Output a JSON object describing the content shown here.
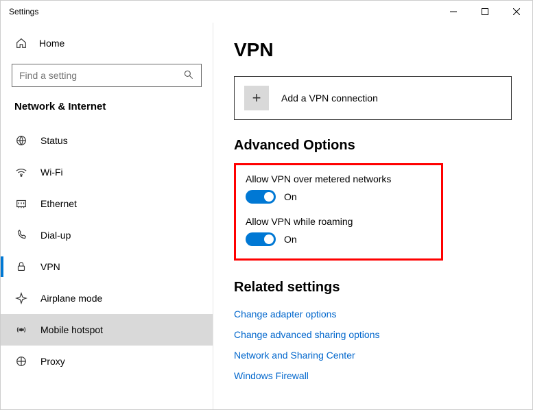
{
  "titlebar": {
    "title": "Settings"
  },
  "sidebar": {
    "home_label": "Home",
    "search_placeholder": "Find a setting",
    "category": "Network & Internet",
    "items": [
      {
        "label": "Status",
        "icon": "status-icon",
        "active": false,
        "highlight": false
      },
      {
        "label": "Wi-Fi",
        "icon": "wifi-icon",
        "active": false,
        "highlight": false
      },
      {
        "label": "Ethernet",
        "icon": "ethernet-icon",
        "active": false,
        "highlight": false
      },
      {
        "label": "Dial-up",
        "icon": "dialup-icon",
        "active": false,
        "highlight": false
      },
      {
        "label": "VPN",
        "icon": "vpn-icon",
        "active": true,
        "highlight": false
      },
      {
        "label": "Airplane mode",
        "icon": "airplane-icon",
        "active": false,
        "highlight": false
      },
      {
        "label": "Mobile hotspot",
        "icon": "hotspot-icon",
        "active": false,
        "highlight": true
      },
      {
        "label": "Proxy",
        "icon": "proxy-icon",
        "active": false,
        "highlight": false
      }
    ]
  },
  "main": {
    "page_title": "VPN",
    "add_connection_label": "Add a VPN connection",
    "advanced_heading": "Advanced Options",
    "toggles": [
      {
        "label": "Allow VPN over metered networks",
        "state": "On"
      },
      {
        "label": "Allow VPN while roaming",
        "state": "On"
      }
    ],
    "related_heading": "Related settings",
    "links": [
      "Change adapter options",
      "Change advanced sharing options",
      "Network and Sharing Center",
      "Windows Firewall"
    ]
  }
}
